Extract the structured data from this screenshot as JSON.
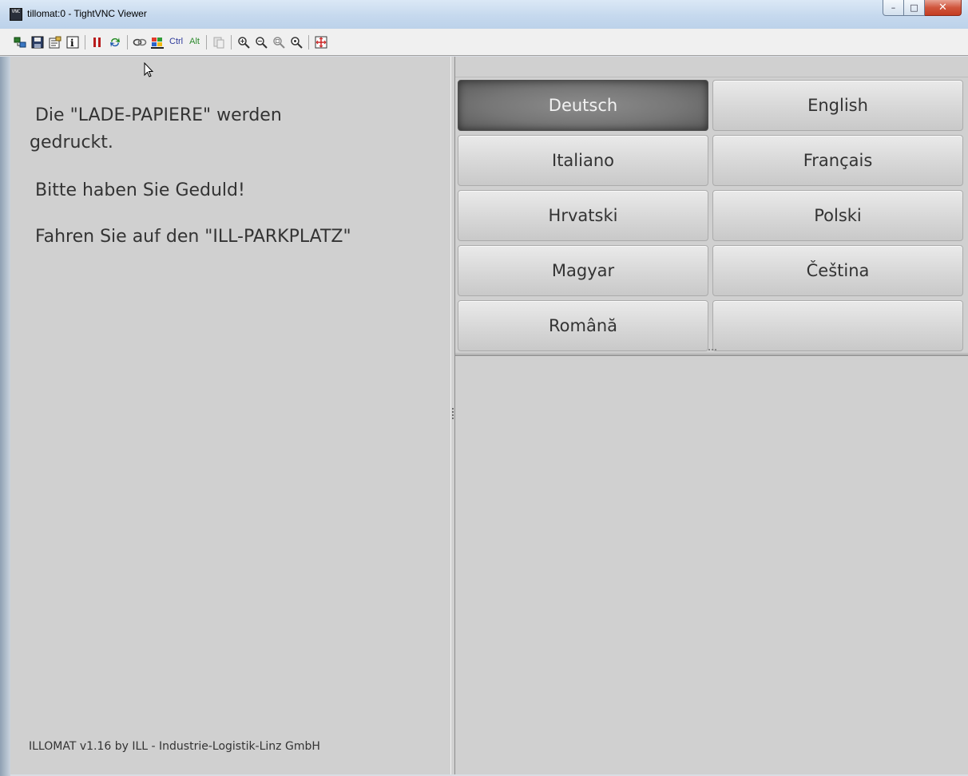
{
  "window": {
    "title": "tillomat:0 - TightVNC Viewer",
    "app_icon": "vnc-icon",
    "app_icon_label": "VNC",
    "controls": {
      "minimize": "–",
      "maximize": "□",
      "close": "✕"
    }
  },
  "toolbar": {
    "icons": [
      "new-connection-icon",
      "save-icon",
      "options-icon",
      "connection-info-icon",
      "pause-icon",
      "refresh-icon",
      "ctrl-alt-del-icon",
      "win-key-icon",
      "clipboard-icon",
      "zoom-in-icon",
      "zoom-out-icon",
      "zoom-100-icon",
      "zoom-auto-icon",
      "fullscreen-icon"
    ],
    "ctrl_label": "Ctrl",
    "alt_label": "Alt"
  },
  "message": {
    "line1": " Die \"LADE-PAPIERE\" werden",
    "line2": "gedruckt.",
    "line3": " Bitte haben Sie Geduld!",
    "line4": " Fahren Sie auf den \"ILL-PARKPLATZ\""
  },
  "footer": "ILLOMAT v1.16 by ILL - Industrie-Logistik-Linz GmbH",
  "languages": {
    "selected": "Deutsch",
    "buttons": [
      "Deutsch",
      "English",
      "Italiano",
      "Français",
      "Hrvatski",
      "Polski",
      "Magyar",
      "Čeština",
      "Română"
    ]
  },
  "colors": {
    "screen_bg": "#d0d0d0",
    "text": "#333333",
    "selected_button": "#767676",
    "titlebar": "#c6d9ee",
    "close_button": "#d0563d"
  }
}
